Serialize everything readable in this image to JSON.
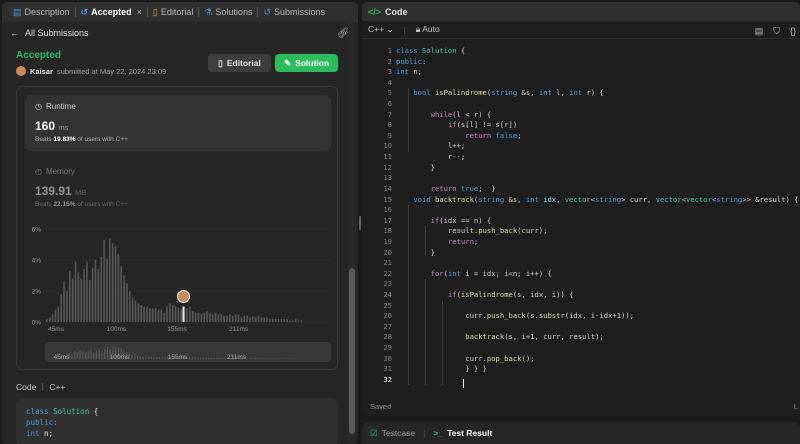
{
  "left_tabs": [
    {
      "label": "Description",
      "icon": "description-icon"
    },
    {
      "label": "Accepted",
      "icon": "history-icon",
      "active": true
    },
    {
      "label": "Editorial",
      "icon": "book-icon"
    },
    {
      "label": "Solutions",
      "icon": "flask-icon"
    },
    {
      "label": "Submissions",
      "icon": "history-icon"
    }
  ],
  "subbar": {
    "back_label": "All Submissions"
  },
  "submission": {
    "status": "Accepted",
    "user": "Kaisar",
    "submitted_text": "submitted at May 22, 2024 23:09"
  },
  "buttons": {
    "editorial": "Editorial",
    "solution": "Solution"
  },
  "runtime": {
    "label": "Runtime",
    "value": "160",
    "unit": "ms",
    "beats_prefix": "Beats",
    "beats_pct": "19.83%",
    "beats_suffix": "of users with C++"
  },
  "memory": {
    "label": "Memory",
    "value": "139.91",
    "unit": "MB",
    "beats_prefix": "Beats",
    "beats_pct": "22.15%",
    "beats_suffix": "of users with C++"
  },
  "chart_data": {
    "type": "bar",
    "y_ticks": [
      "6%",
      "4%",
      "2%",
      "0%"
    ],
    "ylim": [
      0,
      6
    ],
    "x_ticks": [
      "45ms",
      "100ms",
      "155ms",
      "211ms"
    ],
    "xlim": [
      35,
      295
    ],
    "bin_width": 2.6,
    "values": [
      0.2,
      0.3,
      0.5,
      0.8,
      1.0,
      1.8,
      2.6,
      2.0,
      3.3,
      2.8,
      3.9,
      3.2,
      2.8,
      3.4,
      3.9,
      2.7,
      3.5,
      4.0,
      3.4,
      4.2,
      5.3,
      4.1,
      5.4,
      5.1,
      4.9,
      4.4,
      3.6,
      3.0,
      2.5,
      2.0,
      1.6,
      1.4,
      1.2,
      1.1,
      1.0,
      1.0,
      0.9,
      0.9,
      0.9,
      0.8,
      0.8,
      0.6,
      1.0,
      1.2,
      1.1,
      1.0,
      0.9,
      0.8,
      1.0,
      0.9,
      1.0,
      0.7,
      0.6,
      0.6,
      0.5,
      0.6,
      0.7,
      0.6,
      0.5,
      0.6,
      0.5,
      0.5,
      0.4,
      0.4,
      0.5,
      0.4,
      0.5,
      0.5,
      0.3,
      0.4,
      0.4,
      0.3,
      0.4,
      0.3,
      0.4,
      0.3,
      0.3,
      0.3,
      0.2,
      0.2,
      0.2,
      0.2,
      0.2,
      0.2,
      0.2,
      0.1,
      0.1,
      0.2,
      0.1,
      0.1
    ],
    "highlight_x": 160,
    "color": "#595959",
    "highlight_color": "#e6e6e6"
  },
  "mini_chart": {
    "x_ticks": [
      "45ms",
      "100ms",
      "155ms",
      "211ms"
    ]
  },
  "code_section": {
    "label": "Code",
    "lang": "C++",
    "preview": [
      "class Solution {",
      "public:",
      " int n;"
    ]
  },
  "right": {
    "title": "Code",
    "language": "C++",
    "auto": "Auto",
    "saved": "Saved",
    "saved_right": "L",
    "testcase": "Testcase",
    "test_result": "Test Result"
  },
  "code_lines": [
    [
      [
        "kw",
        "class "
      ],
      [
        "cls",
        "Solution "
      ],
      [
        "",
        "{"
      ]
    ],
    [
      [
        "kw",
        "public"
      ],
      [
        "",
        ":"
      ]
    ],
    [
      [
        "",
        ""
      ],
      [
        "kw",
        "int "
      ],
      [
        "",
        "n;"
      ]
    ],
    [
      [
        "",
        ""
      ]
    ],
    [
      [
        "",
        "    "
      ],
      [
        "kw",
        "bool "
      ],
      [
        "fn",
        "isPalindrome"
      ],
      [
        "",
        "("
      ],
      [
        "kw",
        "string "
      ],
      [
        "",
        "&s, "
      ],
      [
        "kw",
        "int "
      ],
      [
        "",
        "l, "
      ],
      [
        "kw",
        "int "
      ],
      [
        "",
        "r) {"
      ]
    ],
    [
      [
        "",
        ""
      ]
    ],
    [
      [
        "",
        "        "
      ],
      [
        "ctl",
        "while"
      ],
      [
        "",
        "(l < r) {"
      ]
    ],
    [
      [
        "",
        "            "
      ],
      [
        "ctl",
        "if"
      ],
      [
        "",
        "(s[l] != s[r])"
      ]
    ],
    [
      [
        "",
        "                "
      ],
      [
        "ctl",
        "return "
      ],
      [
        "kw",
        "false"
      ],
      [
        "",
        ";"
      ]
    ],
    [
      [
        "",
        "            l++;"
      ]
    ],
    [
      [
        "",
        "            r--;"
      ]
    ],
    [
      [
        "",
        "        }"
      ]
    ],
    [
      [
        "",
        ""
      ]
    ],
    [
      [
        "",
        "        "
      ],
      [
        "ctl",
        "return "
      ],
      [
        "kw",
        "true"
      ],
      [
        "",
        ";  }"
      ]
    ],
    [
      [
        "",
        "    "
      ],
      [
        "kw",
        "void "
      ],
      [
        "fn",
        "backtrack"
      ],
      [
        "",
        "("
      ],
      [
        "kw",
        "string "
      ],
      [
        "",
        "&s, "
      ],
      [
        "kw",
        "int "
      ],
      [
        "var",
        "idx"
      ],
      [
        "",
        ", "
      ],
      [
        "cls",
        "vector"
      ],
      [
        "",
        "<"
      ],
      [
        "kw",
        "string"
      ],
      [
        "",
        "> curr, "
      ],
      [
        "cls",
        "vector"
      ],
      [
        "",
        "<"
      ],
      [
        "cls",
        "vector"
      ],
      [
        "",
        "<"
      ],
      [
        "kw",
        "string"
      ],
      [
        "",
        ">> &result) {"
      ]
    ],
    [
      [
        "",
        ""
      ]
    ],
    [
      [
        "",
        "        "
      ],
      [
        "ctl",
        "if"
      ],
      [
        "",
        "(idx == n) {"
      ]
    ],
    [
      [
        "",
        "            result."
      ],
      [
        "fn",
        "push_back"
      ],
      [
        "",
        "(curr);"
      ]
    ],
    [
      [
        "",
        "            "
      ],
      [
        "ctl",
        "return"
      ],
      [
        "",
        ";"
      ]
    ],
    [
      [
        "",
        "        }"
      ]
    ],
    [
      [
        "",
        ""
      ]
    ],
    [
      [
        "",
        "        "
      ],
      [
        "ctl",
        "for"
      ],
      [
        "",
        "("
      ],
      [
        "kw",
        "int "
      ],
      [
        "",
        "i = idx; i<n; i++) {"
      ]
    ],
    [
      [
        "",
        ""
      ]
    ],
    [
      [
        "",
        "            "
      ],
      [
        "ctl",
        "if"
      ],
      [
        "",
        "("
      ],
      [
        "fn",
        "isPalindrome"
      ],
      [
        "",
        "(s, idx, i)) {"
      ]
    ],
    [
      [
        "",
        ""
      ]
    ],
    [
      [
        "",
        "                curr."
      ],
      [
        "fn",
        "push_back"
      ],
      [
        "",
        "(s."
      ],
      [
        "fn",
        "substr"
      ],
      [
        "",
        "(idx, i-idx+1));"
      ]
    ],
    [
      [
        "",
        ""
      ]
    ],
    [
      [
        "",
        "                "
      ],
      [
        "fn",
        "backtrack"
      ],
      [
        "",
        "(s, i+1, curr, result);"
      ]
    ],
    [
      [
        "",
        ""
      ]
    ],
    [
      [
        "",
        "                curr."
      ],
      [
        "fn",
        "pop_back"
      ],
      [
        "",
        "();"
      ]
    ],
    [
      [
        "",
        "                } } }"
      ]
    ],
    [
      [
        "",
        ""
      ]
    ]
  ]
}
